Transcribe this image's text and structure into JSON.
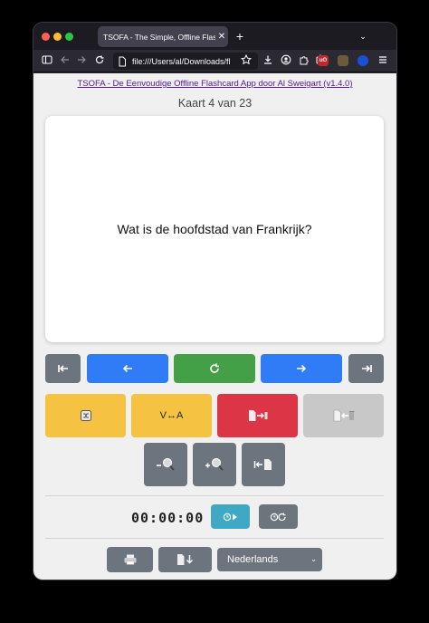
{
  "browser": {
    "tab_title": "TSOFA - The Simple, Offline Flashca",
    "tab_close": "✕",
    "new_tab": "+",
    "tab_list": "⌄",
    "url": "file:///Users/al/Downloads/fl",
    "ext_badges": {
      "ublock": "uO"
    }
  },
  "app": {
    "link_text": "TSOFA - De Eenvoudige Offline Flashcard App door Al Sweigart (v1.4.0)",
    "counter": "Kaart 4 van 23",
    "card_text": "Wat is de hoofdstad van Frankrijk?",
    "swap_label": "V↔A",
    "timer": "00:00:00",
    "language_selected": "Nederlands",
    "select_arrow": "⌄"
  },
  "colors": {
    "blue": "#2f7cf6",
    "green": "#43a047",
    "gray": "#6c757d",
    "yellow": "#f5c242",
    "red": "#dc3545",
    "teal": "#3fa9c5",
    "light_gray": "#c8c8c8"
  },
  "icons": {
    "first": "skip-first-icon",
    "prev": "arrow-left-icon",
    "flip": "flip-refresh-icon",
    "next": "arrow-right-icon",
    "last": "skip-last-icon",
    "shuffle": "shuffle-icon",
    "remove": "remove-card-icon",
    "restore": "restore-card-icon",
    "zoom_out": "zoom-out-icon",
    "zoom_in": "zoom-in-icon",
    "reset": "reset-document-icon",
    "timer_start": "timer-start-icon",
    "timer_reset": "timer-reset-icon",
    "print": "print-icon",
    "download": "download-document-icon"
  }
}
